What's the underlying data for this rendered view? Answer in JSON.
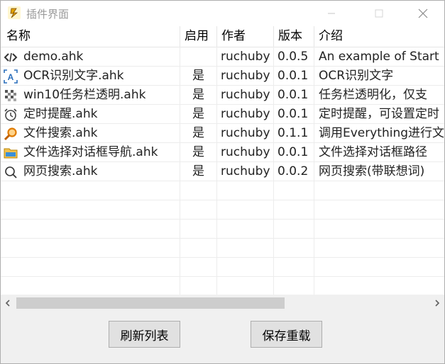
{
  "window": {
    "title": "插件界面",
    "icon": "plugin-app-icon",
    "controls": [
      "minimize-icon",
      "maximize-icon",
      "close-icon"
    ]
  },
  "columns": [
    "名称",
    "启用",
    "作者",
    "版本",
    "介绍"
  ],
  "rows": [
    {
      "name": "demo.ahk",
      "enabled": "",
      "author": "ruchuby",
      "version": "0.0.5",
      "desc": "An example of Start",
      "icon": "code-icon"
    },
    {
      "name": "OCR识别文字.ahk",
      "enabled": "是",
      "author": "ruchuby",
      "version": "0.0.1",
      "desc": "OCR识别文字",
      "icon": "ocr-text-icon"
    },
    {
      "name": "win10任务栏透明.ahk",
      "enabled": "是",
      "author": "ruchuby",
      "version": "0.0.1",
      "desc": "任务栏透明化，仅支",
      "icon": "transparency-icon"
    },
    {
      "name": "定时提醒.ahk",
      "enabled": "是",
      "author": "ruchuby",
      "version": "0.0.1",
      "desc": "定时提醒，可设置定时",
      "icon": "alarm-clock-icon"
    },
    {
      "name": "文件搜索.ahk",
      "enabled": "是",
      "author": "ruchuby",
      "version": "0.1.1",
      "desc": "调用Everything进行文",
      "icon": "file-search-icon"
    },
    {
      "name": "文件选择对话框导航.ahk",
      "enabled": "是",
      "author": "ruchuby",
      "version": "0.0.1",
      "desc": "文件选择对话框路径",
      "icon": "folder-icon"
    },
    {
      "name": "网页搜索.ahk",
      "enabled": "是",
      "author": "ruchuby",
      "version": "0.0.2",
      "desc": "网页搜索(带联想词)",
      "icon": "search-icon"
    }
  ],
  "buttons": {
    "refresh": "刷新列表",
    "save_reload": "保存重载"
  }
}
